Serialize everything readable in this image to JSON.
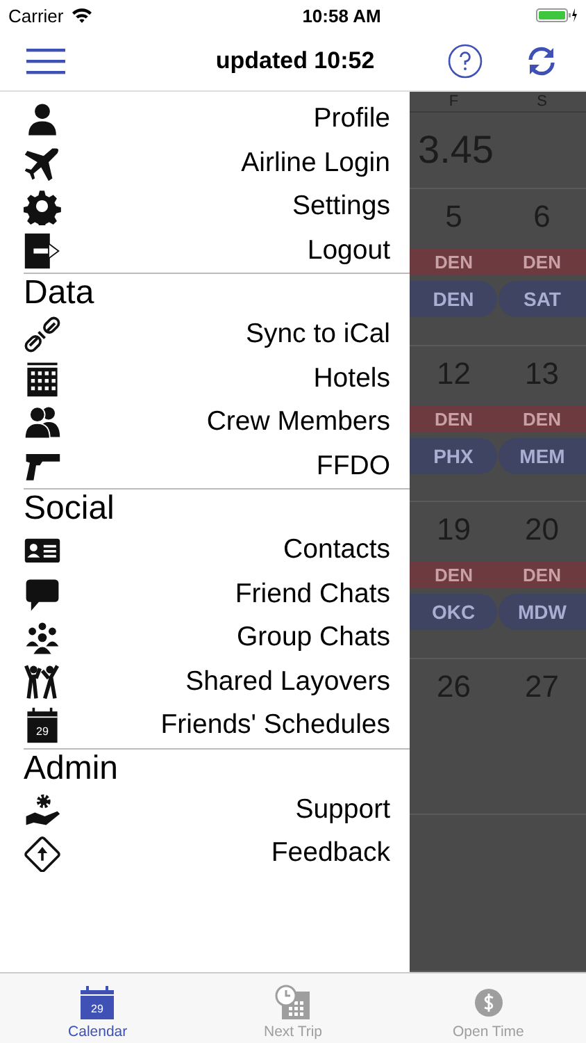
{
  "status_bar": {
    "carrier": "Carrier",
    "time": "10:58 AM"
  },
  "nav_bar": {
    "title": "updated 10:52"
  },
  "menu": {
    "sections": [
      {
        "items": [
          {
            "label": "Profile"
          },
          {
            "label": "Airline Login"
          },
          {
            "label": "Settings"
          },
          {
            "label": "Logout"
          }
        ]
      },
      {
        "title": "Data",
        "items": [
          {
            "label": "Sync to iCal"
          },
          {
            "label": "Hotels"
          },
          {
            "label": "Crew Members"
          },
          {
            "label": "FFDO"
          }
        ]
      },
      {
        "title": "Social",
        "items": [
          {
            "label": "Contacts"
          },
          {
            "label": "Friend Chats"
          },
          {
            "label": "Group Chats"
          },
          {
            "label": "Shared Layovers"
          },
          {
            "label": "Friends' Schedules",
            "icon_text": "29"
          }
        ]
      },
      {
        "title": "Admin",
        "items": [
          {
            "label": "Support"
          },
          {
            "label": "Feedback"
          }
        ]
      }
    ]
  },
  "calendar": {
    "day_headers": [
      "F",
      "S"
    ],
    "rows": [
      {
        "kind": "total",
        "text": "3.45"
      },
      {
        "kind": "week",
        "days": [
          "5",
          "6"
        ],
        "bases": [
          "DEN",
          "DEN"
        ],
        "trips": [
          "DEN",
          "SAT"
        ]
      },
      {
        "kind": "week",
        "days": [
          "12",
          "13"
        ],
        "bases": [
          "DEN",
          "DEN"
        ],
        "trips": [
          "PHX",
          "MEM"
        ]
      },
      {
        "kind": "week",
        "days": [
          "19",
          "20"
        ],
        "bases": [
          "DEN",
          "DEN"
        ],
        "trips": [
          "OKC",
          "MDW"
        ]
      },
      {
        "kind": "week",
        "days": [
          "26",
          "27"
        ]
      },
      {
        "kind": "empty"
      }
    ]
  },
  "tab_bar": [
    {
      "label": "Calendar",
      "selected": true,
      "icon_text": "29"
    },
    {
      "label": "Next Trip",
      "selected": false
    },
    {
      "label": "Open Time",
      "selected": false
    }
  ]
}
